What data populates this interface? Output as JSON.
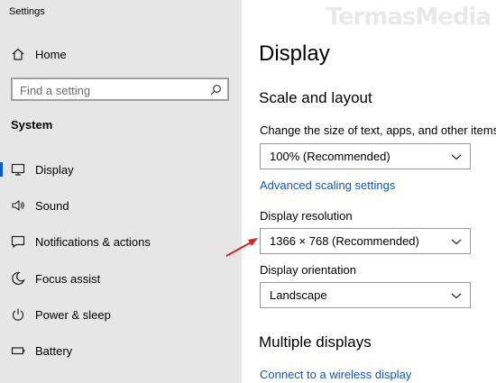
{
  "window": {
    "title": "Settings"
  },
  "sidebar": {
    "home_label": "Home",
    "search_placeholder": "Find a setting",
    "section_label": "System",
    "items": [
      {
        "label": "Display",
        "icon": "monitor-icon",
        "selected": true
      },
      {
        "label": "Sound",
        "icon": "speaker-icon"
      },
      {
        "label": "Notifications & actions",
        "icon": "notification-icon"
      },
      {
        "label": "Focus assist",
        "icon": "moon-icon"
      },
      {
        "label": "Power & sleep",
        "icon": "power-icon"
      },
      {
        "label": "Battery",
        "icon": "battery-icon"
      }
    ]
  },
  "main": {
    "title": "Display",
    "scale_heading": "Scale and layout",
    "scale_label": "Change the size of text, apps, and other items",
    "scale_value": "100% (Recommended)",
    "advanced_link": "Advanced scaling settings",
    "resolution_label": "Display resolution",
    "resolution_value": "1366 × 768 (Recommended)",
    "orientation_label": "Display orientation",
    "orientation_value": "Landscape",
    "multiple_heading": "Multiple displays",
    "wireless_link": "Connect to a wireless display"
  },
  "watermark": "TermasMedia",
  "colors": {
    "accent": "#0a58c9",
    "sidebar_bg": "#e6e6e6",
    "arrow": "#e02020"
  }
}
